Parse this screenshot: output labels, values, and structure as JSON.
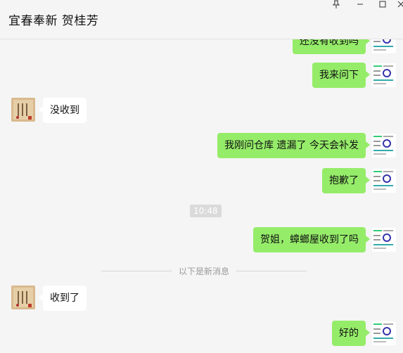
{
  "window": {
    "title": "宜春奉新 贺桂芳",
    "pin_icon": "pin-icon",
    "minimize_icon": "minimize-icon",
    "maximize_icon": "maximize-icon",
    "close_icon": "close-icon"
  },
  "messages": [
    {
      "dir": "out",
      "text": "还没有收到吗"
    },
    {
      "dir": "out",
      "text": "我来问下"
    },
    {
      "dir": "in",
      "text": "没收到"
    },
    {
      "dir": "out",
      "text": "我刚问仓库  遗漏了  今天会补发"
    },
    {
      "dir": "out",
      "text": "抱歉了"
    },
    {
      "dir": "out",
      "text": "贺姐，蟑螂屋收到了吗"
    },
    {
      "dir": "in",
      "text": "收到了"
    },
    {
      "dir": "out",
      "text": "好的"
    }
  ],
  "timestamp": "10:48",
  "divider": "以下是新消息",
  "colors": {
    "outgoing_bubble": "#95ec69",
    "incoming_bubble": "#ffffff",
    "background": "#f5f5f5"
  }
}
